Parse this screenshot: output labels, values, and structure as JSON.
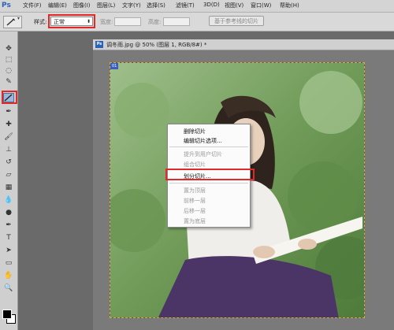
{
  "menubar": {
    "logo": "Ps",
    "items": [
      "文件(F)",
      "编辑(E)",
      "图像(I)",
      "图层(L)",
      "文字(Y)",
      "选择(S)",
      "滤镜(T)",
      "3D(D)",
      "视图(V)",
      "窗口(W)",
      "帮助(H)"
    ]
  },
  "options": {
    "style_label": "样式:",
    "style_value": "正常",
    "width_label": "宽度:",
    "height_label": "高度:",
    "guide_button": "基于参考线的切片"
  },
  "document": {
    "tab_icon": "Ps",
    "title": "调冬雨.jpg @ 50% (图层 1, RGB/8#) *",
    "slice_badge": "01"
  },
  "context_menu": {
    "items": [
      {
        "label": "删除切片",
        "enabled": true
      },
      {
        "label": "编辑切片选项...",
        "enabled": true
      },
      {
        "label": "提升到用户切片",
        "enabled": false
      },
      {
        "label": "组合切片",
        "enabled": false
      },
      {
        "label": "划分切片...",
        "enabled": true
      },
      {
        "label": "置为顶层",
        "enabled": false
      },
      {
        "label": "前移一层",
        "enabled": false
      },
      {
        "label": "后移一层",
        "enabled": false
      },
      {
        "label": "置为底层",
        "enabled": false
      }
    ]
  },
  "colors": {
    "highlight": "#e02a2a",
    "enabled_text": "#111111",
    "disabled_text": "#9a9a9a"
  }
}
